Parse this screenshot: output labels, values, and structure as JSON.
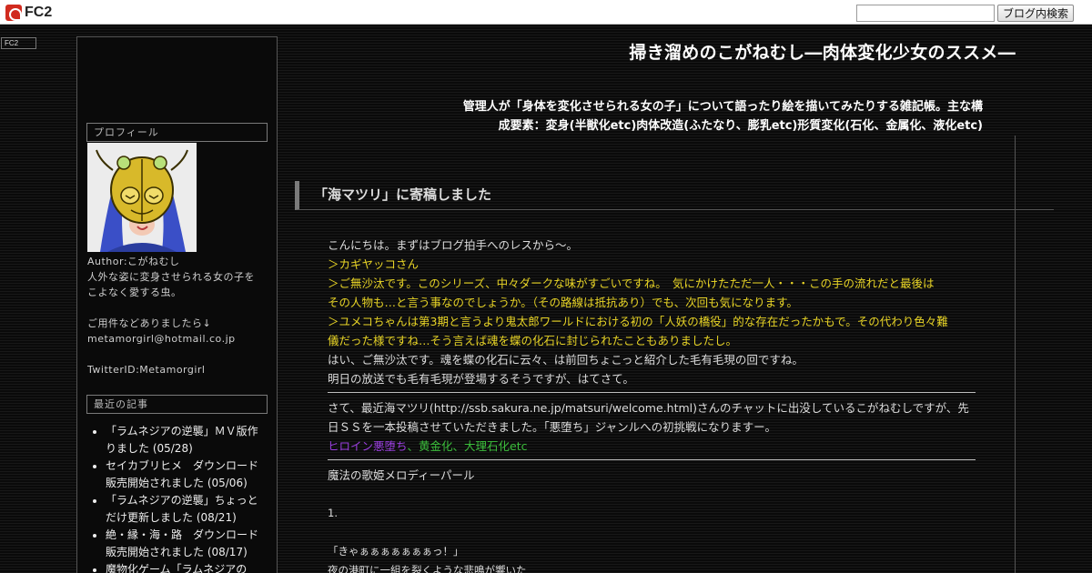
{
  "topbar": {
    "logo_text": "FC2",
    "search_placeholder": "",
    "search_button": "ブログ内検索"
  },
  "mini_badge": "FC2",
  "blog": {
    "title": "掃き溜めのこがねむし―肉体変化少女のススメ―",
    "description_line1": "管理人が「身体を変化させられる女の子」について語ったり絵を描いてみたりする雑記帳。主な構",
    "description_line2": "成要素：変身(半獣化etc)肉体改造(ふたなり、膨乳etc)形質変化(石化、金属化、液化etc)"
  },
  "sidebar": {
    "profile_heading": "プロフィール",
    "author": "Author:こがねむし",
    "intro_line1": "人外な姿に変身させられる女の子を",
    "intro_line2": "こよなく愛する虫。",
    "contact_line": "ご用件などありましたら↓",
    "email": "metamorgirl@hotmail.co.jp",
    "twitter": "TwitterID:Metamorgirl",
    "recent_heading": "最近の記事",
    "recent_items": [
      "「ラムネジアの逆襲」ＭＶ版作りました (05/28)",
      "セイカブリヒメ　ダウンロード販売開始されました (05/06)",
      "「ラムネジアの逆襲」ちょっとだけ更新しました (08/21)",
      "絶・縁・海・路　ダウンロード販売開始されました (08/17)",
      "魔物化ゲーム「ラムネジアの"
    ]
  },
  "post": {
    "title": "「海マツリ」に寄稿しました",
    "p1": "こんにちは。まずはブログ拍手へのレスから～。",
    "p2": "＞カギヤッコさん",
    "p3": "＞ご無沙汰です。このシリーズ、中々ダークな味がすごいですね。　気にかけたただ一人・・・この手の流れだと最後は",
    "p4": "その人物も…と言う事なのでしょうか。（その路線は抵抗あり）でも、次回も気になります。",
    "p5": "＞ユメコちゃんは第3期と言うより鬼太郎ワールドにおける初の「人妖の橋役」的な存在だったかもで。その代わり色々難",
    "p6": "儀だった様ですね…そう言えば魂を蝶の化石に封じられたこともありましたし。",
    "p7": "はい、ご無沙汰です。魂を蝶の化石に云々、は前回ちょこっと紹介した毛有毛現の回ですね。",
    "p8": "明日の放送でも毛有毛現が登場するそうですが、はてさて。",
    "p9": "さて、最近海マツリ(http://ssb.sakura.ne.jp/matsuri/welcome.html)さんのチャットに出没しているこがねむしですが、先",
    "p10": "日ＳＳを一本投稿させていただきました。「悪堕ち」ジャンルへの初挑戦になりますー。",
    "tag_purple": "ヒロイン悪堕ち",
    "tag_sep": "、",
    "tag_green": "黄金化、大理石化etc",
    "story_title": "魔法の歌姫メロディーパール",
    "chapter": "1.",
    "quote": "「きゃぁぁぁぁぁぁぁっ！」",
    "cut_line": "夜の港町に一組を裂くような悲鳴が響いた"
  },
  "colors": {
    "accent_yellow": "#e8d426",
    "tag_purple": "#9b3fe0",
    "tag_green": "#3cbf3c"
  }
}
